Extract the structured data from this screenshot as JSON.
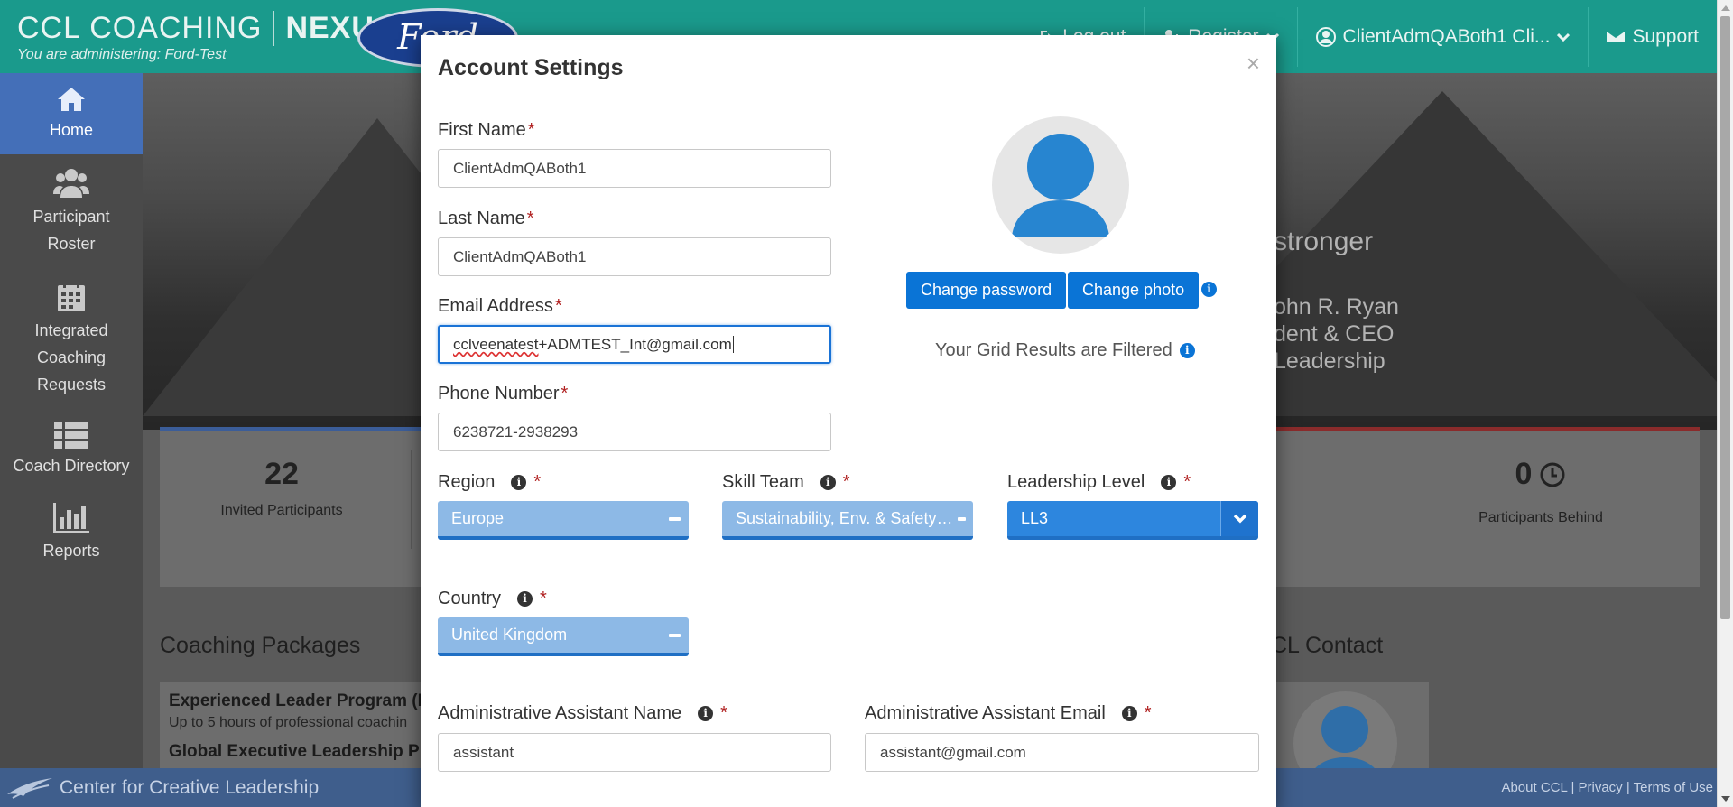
{
  "header": {
    "brand_name": "CCL COACHING",
    "brand_product": "NEXUS",
    "administering": "You are administering: Ford-Test",
    "client_logo_text": "Ford",
    "nav": {
      "logout": "Log out",
      "register": "Register",
      "user": "ClientAdmQABoth1 Cli...",
      "support": "Support"
    }
  },
  "sidebar": {
    "items": [
      {
        "label": "Home"
      },
      {
        "label": "Participant Roster"
      },
      {
        "label": "Integrated Coaching Requests"
      },
      {
        "label": "Coach Directory"
      },
      {
        "label": "Reports"
      }
    ]
  },
  "dashboard": {
    "quote": "stronger",
    "author": "ohn R. Ryan",
    "author_title": "dent & CEO",
    "author_org": "Leadership",
    "stats": [
      {
        "value": "22",
        "label": "Invited Participants"
      },
      {
        "value": "0",
        "label": "Participants Behind"
      }
    ],
    "coaching_packages_title": "Coaching Packages",
    "package_title": "Experienced Leader Program (E",
    "package_sub": "Up to 5 hours of professional coachin",
    "package_next": "Global Executive Leadership Pr",
    "ccl_contact_title": "CL Contact"
  },
  "footer": {
    "org": "Center for Creative Leadership",
    "links": "About CCL | Privacy | Terms of Use"
  },
  "modal": {
    "title": "Account Settings",
    "close": "×",
    "first_name": {
      "label": "First Name",
      "value": "ClientAdmQABoth1"
    },
    "last_name": {
      "label": "Last Name",
      "value": "ClientAdmQABoth1"
    },
    "email": {
      "label": "Email Address",
      "value_part1": "cclveenatest",
      "value_part2": "+ADMTEST_Int@gmail.com"
    },
    "phone": {
      "label": "Phone Number",
      "value": "6238721-2938293"
    },
    "change_password": "Change password",
    "change_photo": "Change photo",
    "filter_text": "Your Grid Results are Filtered",
    "region": {
      "label": "Region",
      "value": "Europe"
    },
    "skill_team": {
      "label": "Skill Team",
      "value": "Sustainability, Env. & Safety E..."
    },
    "leadership_level": {
      "label": "Leadership Level",
      "value": "LL3"
    },
    "country": {
      "label": "Country",
      "value": "United Kingdom"
    },
    "assistant_name": {
      "label": "Administrative Assistant Name",
      "value": "assistant"
    },
    "assistant_email": {
      "label": "Administrative Assistant Email",
      "value": "assistant@gmail.com"
    },
    "required_mark": "*",
    "info_glyph": "i"
  },
  "colors": {
    "header": "#1a9a8c",
    "primary_button": "#0a74d6",
    "select_fill": "#8db9e6",
    "required": "#b02020"
  }
}
